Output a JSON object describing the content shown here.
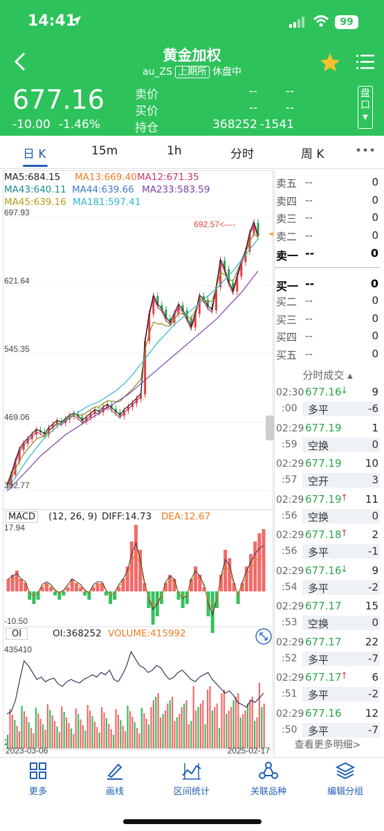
{
  "status": {
    "time": "14:41",
    "battery": "99"
  },
  "header": {
    "title": "黄金加权",
    "code": "au_ZS",
    "exchange": "上期所",
    "state": "休盘中",
    "price": "677.16",
    "change": "-10.00",
    "change_pct": "-1.46%",
    "sell_label": "卖价",
    "sell_v1": "--",
    "sell_v2": "--",
    "buy_label": "买价",
    "buy_v1": "--",
    "buy_v2": "--",
    "oi_label": "持仓",
    "oi_v1": "368252",
    "oi_v2": "-1541",
    "pk1": "盘",
    "pk2": "口",
    "colors": {
      "brand": "#2ec25b",
      "down": "#2aa54a",
      "up": "#e0403f"
    }
  },
  "tabs": [
    "日 K",
    "15m",
    "1h",
    "分时",
    "周 K",
    "•••"
  ],
  "indicators": {
    "ma5": "MA5:684.15",
    "ma13": "MA13:669.40",
    "ma12": "MA12:671.35",
    "ma43": "MA43:640.11",
    "ma44": "MA44:639.66",
    "ma233": "MA233:583.59",
    "ma45": "MA45:639.16",
    "ma181": "MA181:597.41",
    "macd_label": "MACD",
    "macd_params": "(12, 26, 9)",
    "diff": "DIFF:14.73",
    "dea": "DEA:12.67",
    "oi_tab": "OI",
    "oi_value": "OI:368252",
    "volume": "VOLUME:415992"
  },
  "chart_data": {
    "type": "line",
    "price_axis": [
      "697.93",
      "621.64",
      "545.35",
      "469.06",
      "392.77"
    ],
    "ylim": [
      392.77,
      697.93
    ],
    "max_marker": "692.57<----",
    "macd_axis": [
      "17.94",
      "-10.50"
    ],
    "oi_axis": [
      "435410",
      "2"
    ],
    "x_range": [
      "2023-03-06",
      "2025-02-17"
    ],
    "close_series": [
      398,
      410,
      425,
      438,
      445,
      450,
      455,
      460,
      458,
      455,
      462,
      466,
      470,
      468,
      472,
      476,
      478,
      475,
      470,
      474,
      478,
      482,
      480,
      485,
      488,
      484,
      480,
      476,
      482,
      486,
      490,
      495,
      500,
      560,
      590,
      610,
      600,
      595,
      585,
      580,
      590,
      600,
      594,
      585,
      575,
      590,
      610,
      606,
      598,
      594,
      620,
      650,
      640,
      625,
      615,
      632,
      648,
      660,
      680,
      692,
      677
    ],
    "ma_slow_series": [
      394,
      400,
      407,
      414,
      421,
      428,
      434,
      440,
      446,
      451,
      456,
      460,
      464,
      468,
      471,
      474,
      477,
      480,
      483,
      486,
      488,
      490,
      492,
      495,
      498,
      501,
      504,
      508,
      512,
      517,
      522,
      528,
      534,
      540,
      546,
      552,
      558,
      563,
      568,
      573,
      578,
      582,
      586,
      590,
      594,
      598,
      602,
      606,
      610,
      614,
      618,
      623,
      628,
      633,
      638,
      644,
      650,
      656,
      662,
      668,
      674
    ],
    "ma_vslow_series": [
      392,
      396,
      401,
      406,
      411,
      416,
      421,
      426,
      431,
      435,
      439,
      443,
      447,
      451,
      455,
      458,
      461,
      464,
      467,
      470,
      473,
      476,
      479,
      482,
      485,
      488,
      491,
      494,
      497,
      500,
      504,
      508,
      512,
      516,
      520,
      524,
      528,
      532,
      536,
      540,
      544,
      548,
      552,
      556,
      560,
      564,
      568,
      572,
      576,
      580,
      584,
      589,
      594,
      599,
      604,
      609,
      614,
      620,
      626,
      632,
      638
    ],
    "macd_hist": [
      3,
      4,
      5,
      3,
      2,
      -2,
      -3,
      -2,
      1,
      2,
      1,
      -1,
      -2,
      -1,
      1,
      3,
      2,
      1,
      -1,
      -2,
      1,
      2,
      2,
      -1,
      -3,
      -2,
      1,
      3,
      6,
      12,
      16,
      10,
      2,
      -4,
      -8,
      -6,
      -3,
      2,
      4,
      3,
      -2,
      -4,
      -3,
      3,
      6,
      4,
      1,
      -6,
      -10,
      -4,
      4,
      10,
      8,
      2,
      -3,
      2,
      6,
      9,
      12,
      14,
      15
    ],
    "oi_series": [
      150000,
      160000,
      210000,
      300000,
      380000,
      360000,
      330000,
      300000,
      310000,
      290000,
      300000,
      305000,
      280000,
      270000,
      290000,
      300000,
      290000,
      285000,
      300000,
      310000,
      320000,
      310000,
      330000,
      320000,
      340000,
      300000,
      290000,
      320000,
      360000,
      420000,
      390000,
      360000,
      350000,
      330000,
      340000,
      360000,
      350000,
      320000,
      300000,
      310000,
      330000,
      340000,
      320000,
      300000,
      290000,
      310000,
      320000,
      330000,
      300000,
      280000,
      260000,
      240000,
      250000,
      230000,
      200000,
      190000,
      180000,
      210000,
      200000,
      220000,
      240000
    ]
  },
  "orderbook": [
    {
      "label": "卖五",
      "price": "--",
      "vol": "0"
    },
    {
      "label": "卖四",
      "price": "--",
      "vol": "0"
    },
    {
      "label": "卖三",
      "price": "--",
      "vol": "0"
    },
    {
      "label": "卖二",
      "price": "--",
      "vol": "0"
    },
    {
      "label": "卖一",
      "price": "--",
      "vol": "0"
    },
    {
      "label": "买一",
      "price": "--",
      "vol": "0"
    },
    {
      "label": "买二",
      "price": "--",
      "vol": "0"
    },
    {
      "label": "买三",
      "price": "--",
      "vol": "0"
    },
    {
      "label": "买四",
      "price": "--",
      "vol": "0"
    },
    {
      "label": "买五",
      "price": "--",
      "vol": "0"
    }
  ],
  "ticks_header": "分时成交 ▴",
  "ticks": [
    {
      "hm": "02:30",
      "sec": ":00",
      "price": "677.16",
      "dir": "↓",
      "vol": "9",
      "kind": "多平",
      "oi": "-6"
    },
    {
      "hm": "02:29",
      "sec": ":59",
      "price": "677.19",
      "dir": "",
      "vol": "1",
      "kind": "空换",
      "oi": "0"
    },
    {
      "hm": "02:29",
      "sec": ":57",
      "price": "677.19",
      "dir": "",
      "vol": "10",
      "kind": "空开",
      "oi": "3"
    },
    {
      "hm": "02:29",
      "sec": ":56",
      "price": "677.19",
      "dir": "↑",
      "vol": "11",
      "kind": "空换",
      "oi": "0"
    },
    {
      "hm": "02:29",
      "sec": ":56",
      "price": "677.18",
      "dir": "↑",
      "vol": "2",
      "kind": "多平",
      "oi": "-1"
    },
    {
      "hm": "02:29",
      "sec": ":54",
      "price": "677.16",
      "dir": "↓",
      "vol": "9",
      "kind": "多平",
      "oi": "-2"
    },
    {
      "hm": "02:29",
      "sec": ":53",
      "price": "677.17",
      "dir": "",
      "vol": "15",
      "kind": "空换",
      "oi": "0"
    },
    {
      "hm": "02:29",
      "sec": ":52",
      "price": "677.17",
      "dir": "",
      "vol": "22",
      "kind": "多平",
      "oi": "-7"
    },
    {
      "hm": "02:29",
      "sec": ":51",
      "price": "677.17",
      "dir": "↑",
      "vol": "6",
      "kind": "多平",
      "oi": "-2"
    },
    {
      "hm": "02:29",
      "sec": ":50",
      "price": "677.16",
      "dir": "",
      "vol": "12",
      "kind": "多平",
      "oi": "-7"
    }
  ],
  "more_label": "查看更多明细>",
  "bottom": [
    "更多",
    "画线",
    "区间统计",
    "关联品种",
    "编辑分组"
  ]
}
